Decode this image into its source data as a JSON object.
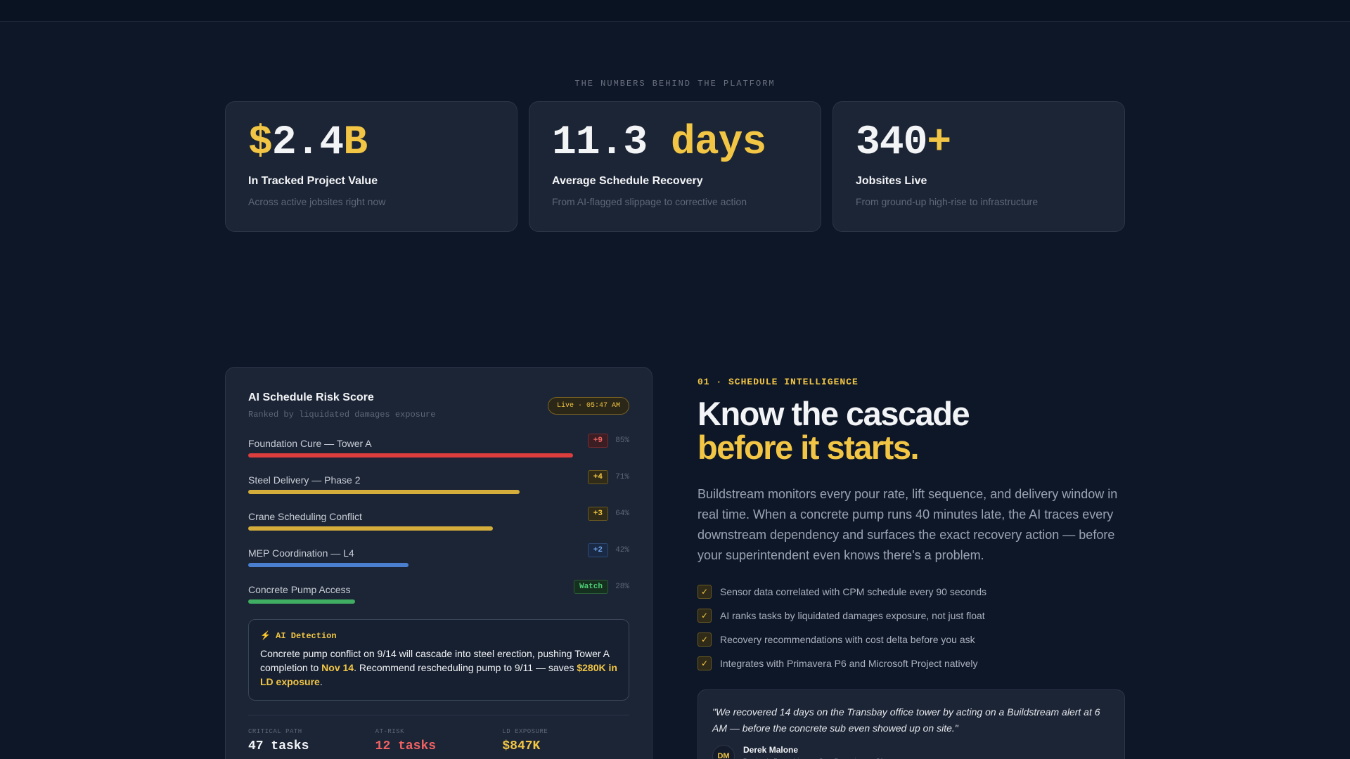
{
  "stats_section": {
    "eyebrow": "THE NUMBERS BEHIND THE PLATFORM",
    "cards": [
      {
        "num_a": "$",
        "num_b": "2.4",
        "num_c": "B",
        "label": "In Tracked Project Value",
        "sub": "Across active jobsites right now"
      },
      {
        "num_a": "",
        "num_b": "11.3 ",
        "num_c": "days",
        "label": "Average Schedule Recovery",
        "sub": "From AI-flagged slippage to corrective action"
      },
      {
        "num_a": "",
        "num_b": "340",
        "num_c": "+",
        "label": "Jobsites Live",
        "sub": "From ground-up high-rise to infrastructure"
      }
    ]
  },
  "risk_panel": {
    "title": "AI Schedule Risk Score",
    "subtitle": "Ranked by liquidated damages exposure",
    "live_label": "Live · 05:47 AM",
    "items": [
      {
        "name": "Foundation Cure — Tower A",
        "badge": "+9",
        "pct": "85%",
        "value": 0.85,
        "color": "#dc3d3d",
        "badge_bg": "#3a1e24",
        "badge_border": "#7a2a2f",
        "badge_fg": "#f06262"
      },
      {
        "name": "Steel Delivery — Phase 2",
        "badge": "+4",
        "pct": "71%",
        "value": 0.71,
        "color": "#d4ad3a",
        "badge_bg": "#2f2b18",
        "badge_border": "#6b5a1f",
        "badge_fg": "#f2c644"
      },
      {
        "name": "Crane Scheduling Conflict",
        "badge": "+3",
        "pct": "64%",
        "value": 0.64,
        "color": "#d4ad3a",
        "badge_bg": "#2f2b18",
        "badge_border": "#6b5a1f",
        "badge_fg": "#f2c644"
      },
      {
        "name": "MEP Coordination — L4",
        "badge": "+2",
        "pct": "42%",
        "value": 0.42,
        "color": "#4a7fd0",
        "badge_bg": "#1a2a44",
        "badge_border": "#2d4a78",
        "badge_fg": "#6a9ee8"
      },
      {
        "name": "Concrete Pump Access",
        "badge": "Watch",
        "pct": "28%",
        "value": 0.28,
        "color": "#3fae62",
        "badge_bg": "#16301f",
        "badge_border": "#2a5a38",
        "badge_fg": "#4ccb74"
      }
    ],
    "ai": {
      "label": "⚡ AI Detection",
      "text_1": "Concrete pump conflict on 9/14 will cascade into steel erection, pushing Tower A completion to ",
      "hl_1": "Nov 14",
      "text_2": ". Recommend rescheduling pump to 9/11 — saves ",
      "hl_2": "$280K in LD exposure",
      "text_3": "."
    },
    "metrics": [
      {
        "label": "CRITICAL PATH",
        "value": "47 tasks",
        "color": "#f3f4f6"
      },
      {
        "label": "AT-RISK",
        "value": "12 tasks",
        "color": "#f06262"
      },
      {
        "label": "LD EXPOSURE",
        "value": "$847K",
        "color": "#f2c644"
      }
    ]
  },
  "feature": {
    "eyebrow": "01 · SCHEDULE INTELLIGENCE",
    "title_1": "Know the cascade",
    "title_2": "before it starts.",
    "body": "Buildstream monitors every pour rate, lift sequence, and delivery window in real time. When a concrete pump runs 40 minutes late, the AI traces every downstream dependency and surfaces the exact recovery action — before your superintendent even knows there's a problem.",
    "checks": [
      "Sensor data correlated with CPM schedule every 90 seconds",
      "AI ranks tasks by liquidated damages exposure, not just float",
      "Recovery recommendations with cost delta before you ask",
      "Integrates with Primavera P6 and Microsoft Project natively"
    ],
    "check_icon": "✓",
    "quote": {
      "text": "\"We recovered 14 days on the Transbay office tower by acting on a Buildstream alert at 6 AM — before the concrete sub even showed up on site.\"",
      "initials": "DM",
      "name": "Derek Malone",
      "role": "Project Executive · San Francisco, CA"
    }
  },
  "colors": {
    "accent": "#f2c644",
    "background": "#0e1728",
    "card": "#1c2536"
  }
}
